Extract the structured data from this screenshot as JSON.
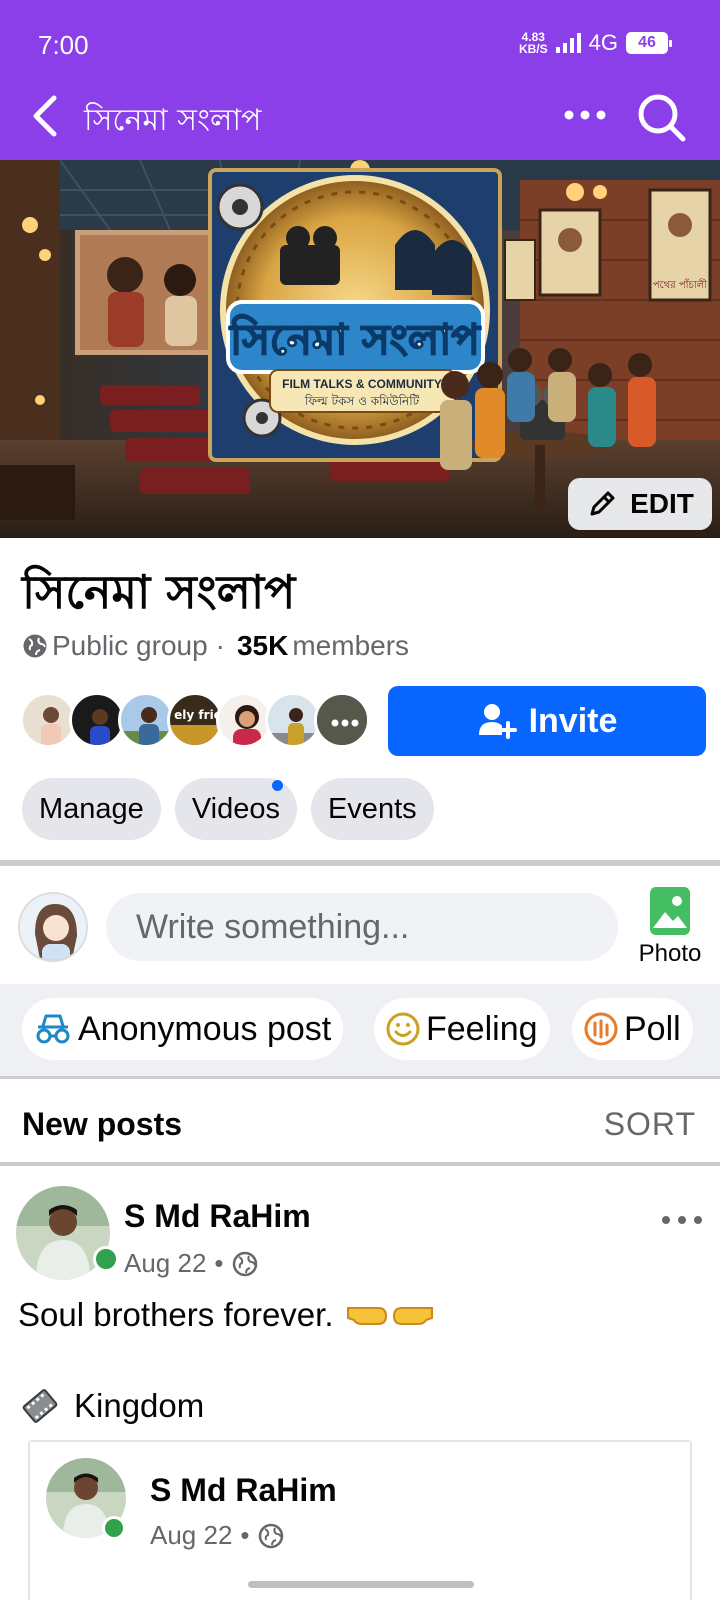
{
  "status_bar": {
    "time": "7:00",
    "speed_value": "4.83",
    "speed_unit": "KB/S",
    "network": "4G",
    "battery": "46"
  },
  "header": {
    "title": "সিনেমা সংলাপ",
    "back_icon": "back-arrow-icon",
    "more_icon": "more-icon",
    "search_icon": "search-icon"
  },
  "cover": {
    "banner_title": "সিনেমা সংলাপ",
    "banner_subtitle": "FILM TALKS & COMMUNITY",
    "banner_subtitle_bn": "ফিল্ম টকস ও কমিউনিটি",
    "poster_text": "পথের পাঁচালী",
    "edit_label": "EDIT"
  },
  "group": {
    "name": "সিনেমা সংলাপ",
    "privacy": "Public group",
    "separator": "·",
    "member_count": "35K",
    "members_label": "members",
    "invite_label": "Invite",
    "avatar_tag": "ely frie"
  },
  "chips": {
    "manage": "Manage",
    "videos": "Videos",
    "events": "Events"
  },
  "composer": {
    "placeholder": "Write something...",
    "photo_label": "Photo"
  },
  "actions": {
    "anonymous": "Anonymous post",
    "feeling": "Feeling",
    "poll": "Poll"
  },
  "feed": {
    "heading": "New posts",
    "sort_label": "SORT"
  },
  "post": {
    "author": "S Md RaHim",
    "date": "Aug 22",
    "dot": "•",
    "text": "Soul brothers forever.",
    "topic": "Kingdom",
    "shared_author": "S Md RaHim",
    "shared_date": "Aug 22"
  },
  "colors": {
    "brand": "#8b3fe8",
    "primary": "#0866ff",
    "online": "#31a24c"
  }
}
